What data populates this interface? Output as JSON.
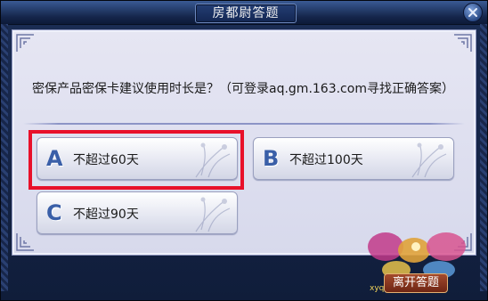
{
  "window": {
    "title": "房都尉答题"
  },
  "question": {
    "text": "密保产品密保卡建议使用时长是？（可登录aq.gm.163.com寻找正确答案）"
  },
  "options": [
    {
      "letter": "A",
      "label": "不超过60天",
      "highlighted": true
    },
    {
      "letter": "B",
      "label": "不超过100天",
      "highlighted": false
    },
    {
      "letter": "C",
      "label": "不超过90天",
      "highlighted": false
    }
  ],
  "footer": {
    "leave_label": "离开答题",
    "logo_url": "xyq.163.com"
  },
  "colors": {
    "highlight": "#e8102a",
    "option_letter": "#3a5fa8",
    "frame": "#14254a"
  },
  "icons": {
    "close": "close-icon",
    "corner": "corner-ornament-icon",
    "flower": "orchid-decoration-icon",
    "logo": "game-logo-icon"
  }
}
